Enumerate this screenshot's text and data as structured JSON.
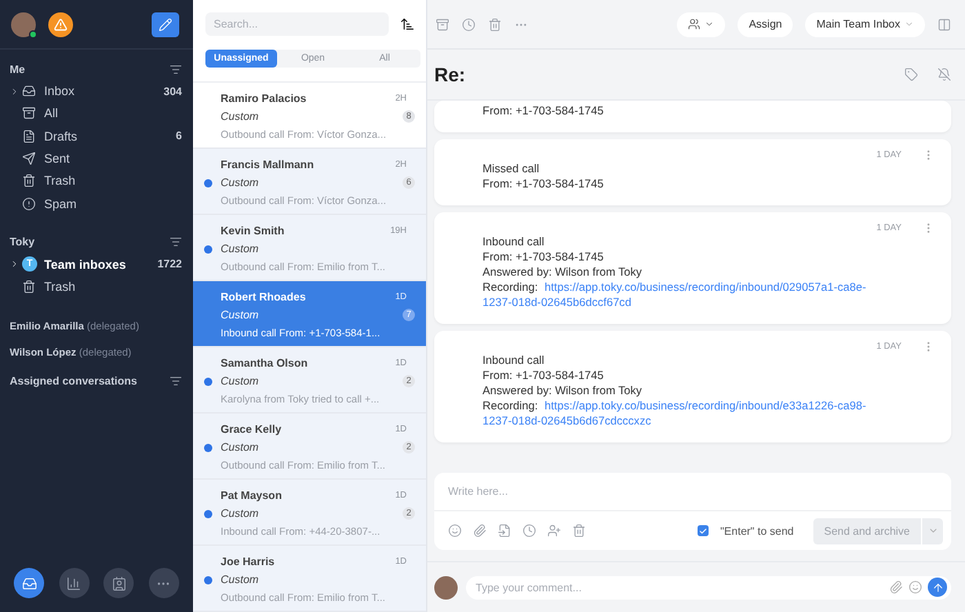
{
  "sidebar": {
    "user": {
      "online": true
    },
    "sections": [
      {
        "title": "Me",
        "items": [
          {
            "label": "Inbox",
            "count": "304",
            "expandable": true,
            "bold": false
          },
          {
            "label": "All",
            "bold": false
          },
          {
            "label": "Drafts",
            "count": "6",
            "bold": false
          },
          {
            "label": "Sent",
            "bold": false
          },
          {
            "label": "Trash",
            "bold": false
          },
          {
            "label": "Spam",
            "bold": false
          }
        ]
      },
      {
        "title": "Toky",
        "items": [
          {
            "label": "Team inboxes",
            "count": "1722",
            "expandable": true,
            "bold": true,
            "avatar": "T"
          },
          {
            "label": "Trash",
            "bold": false
          }
        ]
      }
    ],
    "delegated": [
      {
        "name": "Emilio Amarilla",
        "note": "(delegated)"
      },
      {
        "name": "Wilson López",
        "note": "(delegated)"
      }
    ],
    "assigned": {
      "title": "Assigned conversations"
    },
    "nav": [
      {
        "selected": true
      },
      {
        "selected": false
      },
      {
        "selected": false
      },
      {
        "selected": false
      }
    ]
  },
  "list": {
    "search": {
      "placeholder": "Search..."
    },
    "tabs": [
      {
        "label": "Unassigned",
        "selected": true
      },
      {
        "label": "Open",
        "selected": false
      },
      {
        "label": "All",
        "selected": false
      }
    ],
    "conversations": [
      {
        "name": "Ramiro Palacios",
        "time": "2H",
        "tag": "Custom",
        "preview": "Outbound call From: Víctor Gonza...",
        "count": "8",
        "unread": false,
        "selected": false
      },
      {
        "name": "Francis Mallmann",
        "time": "2H",
        "tag": "Custom",
        "preview": "Outbound call From: Víctor Gonza...",
        "count": "6",
        "unread": true,
        "selected": false
      },
      {
        "name": "Kevin Smith",
        "time": "19H",
        "tag": "Custom",
        "preview": "Outbound call From: Emilio from T...",
        "unread": true,
        "selected": false
      },
      {
        "name": "Robert Rhoades",
        "time": "1D",
        "tag": "Custom",
        "preview": "Inbound call From: +1-703-584-1...",
        "count": "7",
        "unread": false,
        "selected": true
      },
      {
        "name": "Samantha Olson",
        "time": "1D",
        "tag": "Custom",
        "preview": "Karolyna from Toky tried to call +...",
        "count": "2",
        "unread": true,
        "selected": false
      },
      {
        "name": "Grace Kelly",
        "time": "1D",
        "tag": "Custom",
        "preview": "Outbound call From: Emilio from T...",
        "count": "2",
        "unread": true,
        "selected": false
      },
      {
        "name": "Pat Mayson",
        "time": "1D",
        "tag": "Custom",
        "preview": "Inbound call From: +44-20-3807-...",
        "count": "2",
        "unread": true,
        "selected": false
      },
      {
        "name": "Joe Harris",
        "time": "1D",
        "tag": "Custom",
        "preview": "Outbound call From: Emilio from T...",
        "unread": true,
        "selected": false
      }
    ]
  },
  "main": {
    "toolbar": {
      "assign": "Assign",
      "inbox": "Main Team Inbox"
    },
    "title": "Re:",
    "messages": [
      {
        "lines": [
          "From: +1-703-584-1745"
        ]
      },
      {
        "time": "1 DAY",
        "lines": [
          "Missed call",
          "From: +1-703-584-1745"
        ]
      },
      {
        "time": "1 DAY",
        "lines": [
          "Inbound call",
          "From: +1-703-584-1745",
          "Answered by: Wilson from Toky"
        ],
        "recording": {
          "label": "Recording:",
          "url": "https://app.toky.co/business/recording/inbound/029057a1-ca8e-1237-018d-02645b6dccf67cd"
        }
      },
      {
        "time": "1 DAY",
        "lines": [
          "Inbound call",
          "From: +1-703-584-1745",
          "Answered by: Wilson from Toky"
        ],
        "recording": {
          "label": "Recording:",
          "url": "https://app.toky.co/business/recording/inbound/e33a1226-ca98-1237-018d-02645b6d67cdcccxzc"
        }
      }
    ],
    "composer": {
      "placeholder": "Write here...",
      "enter_to_send": {
        "label": "\"Enter\" to send",
        "checked": true
      },
      "send": {
        "label": "Send and archive",
        "disabled": true
      }
    },
    "comment": {
      "placeholder": "Type your comment..."
    }
  }
}
